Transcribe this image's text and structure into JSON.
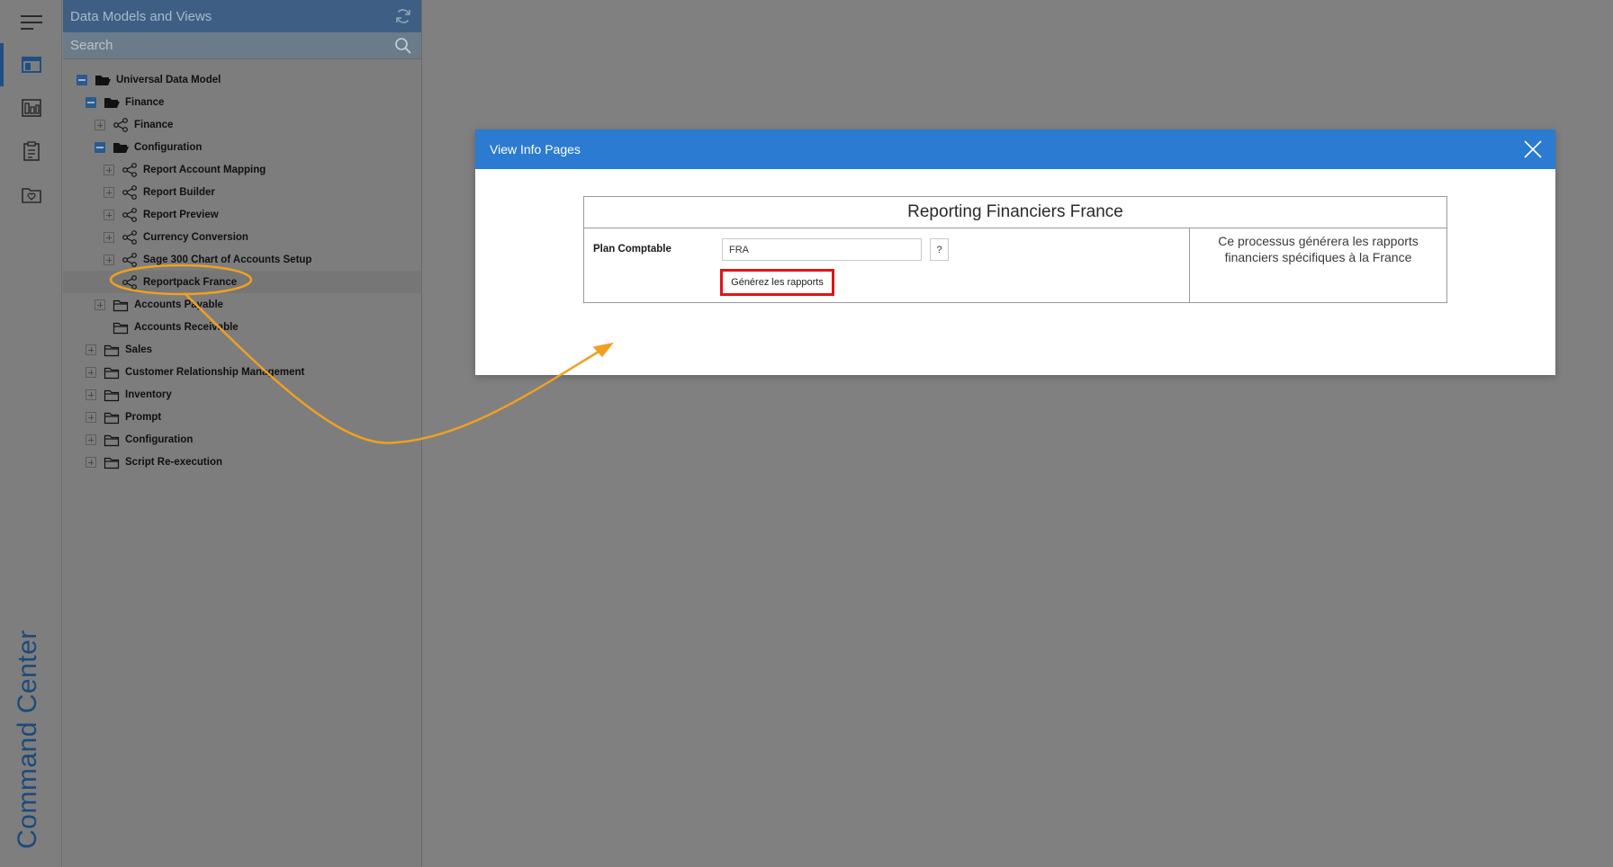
{
  "rail": {
    "app_title": "Command Center",
    "items": [
      {
        "icon": "menu-icon"
      },
      {
        "icon": "data-models-icon",
        "active": true
      },
      {
        "icon": "dashboard-icon"
      },
      {
        "icon": "clipboard-icon"
      },
      {
        "icon": "favorites-folder-icon"
      }
    ]
  },
  "panel": {
    "title": "Data Models and Views",
    "search_placeholder": "Search"
  },
  "tree": [
    {
      "label": "Universal Data Model",
      "level": 0,
      "toggle": "minus",
      "icon": "folder-open"
    },
    {
      "label": "Finance",
      "level": 1,
      "toggle": "minus",
      "icon": "folder-open"
    },
    {
      "label": "Finance",
      "level": 2,
      "toggle": "plus",
      "icon": "share"
    },
    {
      "label": "Configuration",
      "level": 2,
      "toggle": "minus",
      "icon": "folder-open"
    },
    {
      "label": "Report Account Mapping",
      "level": 3,
      "toggle": "plus",
      "icon": "share"
    },
    {
      "label": "Report Builder",
      "level": 3,
      "toggle": "plus",
      "icon": "share"
    },
    {
      "label": "Report Preview",
      "level": 3,
      "toggle": "plus",
      "icon": "share"
    },
    {
      "label": "Currency Conversion",
      "level": 3,
      "toggle": "plus",
      "icon": "share"
    },
    {
      "label": "Sage 300 Chart of Accounts Setup",
      "level": 3,
      "toggle": "plus",
      "icon": "share"
    },
    {
      "label": "Reportpack France",
      "level": 3,
      "toggle": "none",
      "icon": "share",
      "selected": true
    },
    {
      "label": "Accounts Payable",
      "level": 2,
      "toggle": "plus",
      "icon": "folder"
    },
    {
      "label": "Accounts Receivable",
      "level": 2,
      "toggle": "none",
      "icon": "folder"
    },
    {
      "label": "Sales",
      "level": 1,
      "toggle": "plus",
      "icon": "folder"
    },
    {
      "label": "Customer Relationship Management",
      "level": 1,
      "toggle": "plus",
      "icon": "folder"
    },
    {
      "label": "Inventory",
      "level": 1,
      "toggle": "plus",
      "icon": "folder"
    },
    {
      "label": "Prompt",
      "level": 1,
      "toggle": "plus",
      "icon": "folder"
    },
    {
      "label": "Configuration",
      "level": 1,
      "toggle": "plus",
      "icon": "folder"
    },
    {
      "label": "Script Re-execution",
      "level": 1,
      "toggle": "plus",
      "icon": "folder"
    }
  ],
  "modal": {
    "title": "View Info Pages",
    "info_title": "Reporting Financiers France",
    "field_label": "Plan Comptable",
    "field_value": "FRA",
    "help_label": "?",
    "generate_label": "Générez les rapports",
    "description": "Ce processus générera les rapports financiers spécifiques à la France"
  },
  "colors": {
    "accent": "#2a7bd1",
    "panel_header": "#3e5f83",
    "annotation": "#f0a020",
    "highlight_border": "#e01414",
    "rail_title": "#1c4a7a"
  }
}
